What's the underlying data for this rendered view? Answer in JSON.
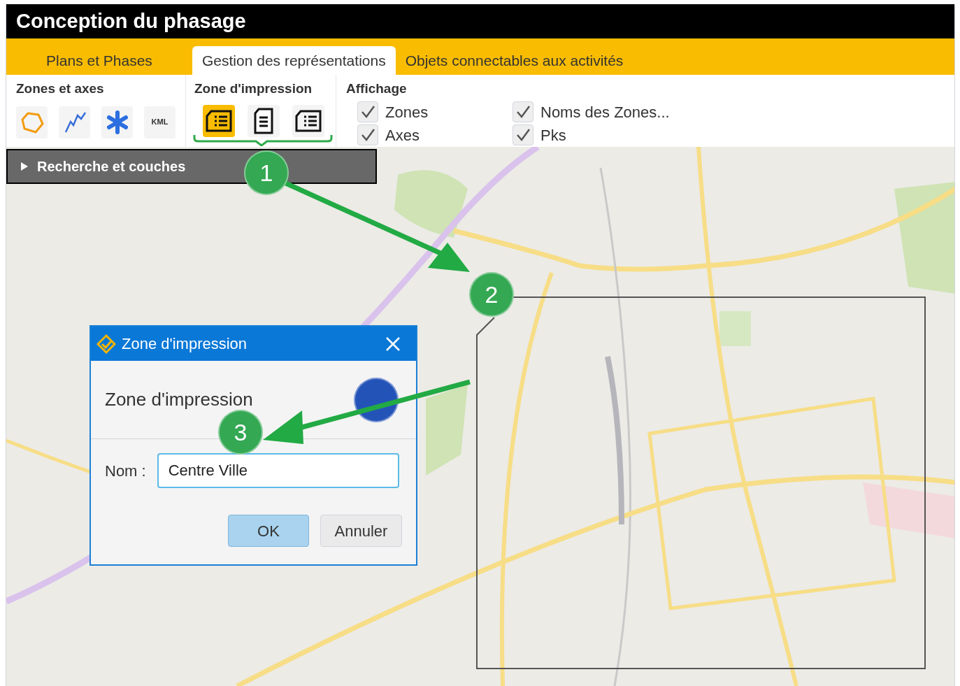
{
  "window": {
    "title": "Conception du phasage"
  },
  "tabs": [
    {
      "label": "Plans et Phases",
      "selected": false
    },
    {
      "label": "Gestion des représentations",
      "selected": true
    },
    {
      "label": "Objets connectables aux activités",
      "selected": false
    }
  ],
  "ribbon": {
    "zones_et_axes": {
      "title": "Zones et axes",
      "buttons": [
        {
          "kind": "polygon"
        },
        {
          "kind": "polyline"
        },
        {
          "kind": "asterisk"
        },
        {
          "kind": "kml",
          "label": "KML"
        }
      ]
    },
    "zone_impression": {
      "title": "Zone d'impression",
      "buttons": [
        {
          "kind": "landscape",
          "selected": true
        },
        {
          "kind": "portrait",
          "selected": false
        },
        {
          "kind": "landscape",
          "selected": false
        }
      ]
    },
    "affichage": {
      "title": "Affichage",
      "checkboxes": [
        {
          "label": "Zones",
          "checked": true
        },
        {
          "label": "Axes",
          "checked": true
        },
        {
          "label": "Noms des Zones...",
          "checked": true
        },
        {
          "label": "Pks",
          "checked": true
        }
      ]
    }
  },
  "panel": {
    "title": "Recherche et couches",
    "expanded": false
  },
  "dialog": {
    "title": "Zone d'impression",
    "heading": "Zone d'impression",
    "field": {
      "label": "Nom :",
      "value": "Centre Ville"
    },
    "buttons": [
      {
        "label": "OK",
        "default": true
      },
      {
        "label": "Annuler",
        "default": false
      }
    ]
  },
  "callouts": [
    {
      "label": "1",
      "color": "#34a853"
    },
    {
      "label": "2",
      "color": "#34a853"
    },
    {
      "label": "3",
      "color": "#34a853"
    },
    {
      "color": "#2453b8"
    }
  ]
}
